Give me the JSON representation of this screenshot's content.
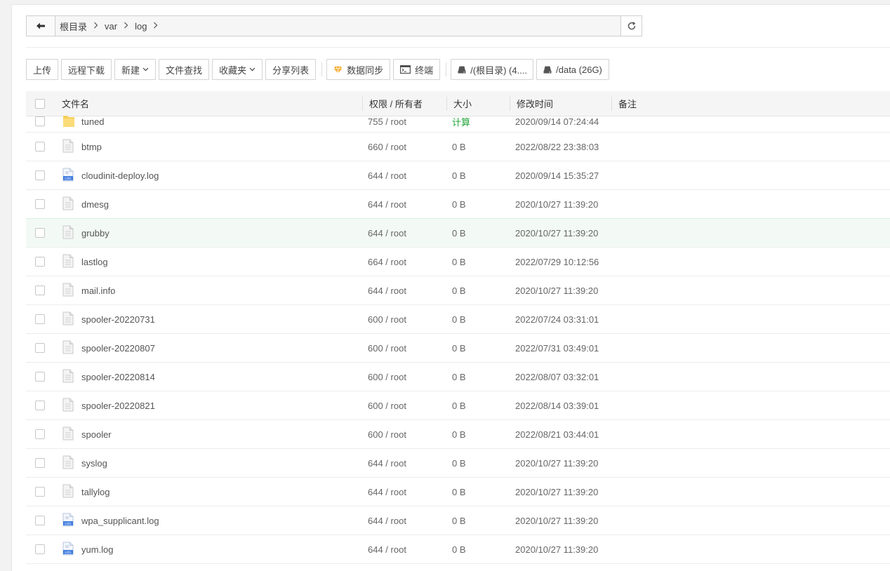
{
  "path": {
    "crumbs": [
      "根目录",
      "var",
      "log"
    ]
  },
  "toolbar": {
    "upload": "上传",
    "remote_download": "远程下载",
    "new": "新建",
    "file_search": "文件查找",
    "favorites": "收藏夹",
    "share_list": "分享列表",
    "data_sync": "数据同步",
    "terminal": "终端",
    "disk_root": "/(根目录) (4....",
    "disk_data": "/data (26G)"
  },
  "table": {
    "headers": {
      "name": "文件名",
      "perm": "权限 / 所有者",
      "size": "大小",
      "mtime": "修改时间",
      "note": "备注"
    },
    "rows": [
      {
        "name": "tuned",
        "type": "folder",
        "perm": "755 / root",
        "size": "计算",
        "mtime": "2020/09/14 07:24:44"
      },
      {
        "name": "btmp",
        "type": "file",
        "perm": "660 / root",
        "size": "0 B",
        "mtime": "2022/08/22 23:38:03"
      },
      {
        "name": "cloudinit-deploy.log",
        "type": "log",
        "perm": "644 / root",
        "size": "0 B",
        "mtime": "2020/09/14 15:35:27"
      },
      {
        "name": "dmesg",
        "type": "file",
        "perm": "644 / root",
        "size": "0 B",
        "mtime": "2020/10/27 11:39:20"
      },
      {
        "name": "grubby",
        "type": "file",
        "perm": "644 / root",
        "size": "0 B",
        "mtime": "2020/10/27 11:39:20"
      },
      {
        "name": "lastlog",
        "type": "file",
        "perm": "664 / root",
        "size": "0 B",
        "mtime": "2022/07/29 10:12:56"
      },
      {
        "name": "mail.info",
        "type": "file",
        "perm": "644 / root",
        "size": "0 B",
        "mtime": "2020/10/27 11:39:20"
      },
      {
        "name": "spooler-20220731",
        "type": "file",
        "perm": "600 / root",
        "size": "0 B",
        "mtime": "2022/07/24 03:31:01"
      },
      {
        "name": "spooler-20220807",
        "type": "file",
        "perm": "600 / root",
        "size": "0 B",
        "mtime": "2022/07/31 03:49:01"
      },
      {
        "name": "spooler-20220814",
        "type": "file",
        "perm": "600 / root",
        "size": "0 B",
        "mtime": "2022/08/07 03:32:01"
      },
      {
        "name": "spooler-20220821",
        "type": "file",
        "perm": "600 / root",
        "size": "0 B",
        "mtime": "2022/08/14 03:39:01"
      },
      {
        "name": "spooler",
        "type": "file",
        "perm": "600 / root",
        "size": "0 B",
        "mtime": "2022/08/21 03:44:01"
      },
      {
        "name": "syslog",
        "type": "file",
        "perm": "644 / root",
        "size": "0 B",
        "mtime": "2020/10/27 11:39:20"
      },
      {
        "name": "tallylog",
        "type": "file",
        "perm": "644 / root",
        "size": "0 B",
        "mtime": "2020/10/27 11:39:20"
      },
      {
        "name": "wpa_supplicant.log",
        "type": "log",
        "perm": "644 / root",
        "size": "0 B",
        "mtime": "2020/10/27 11:39:20"
      },
      {
        "name": "yum.log",
        "type": "log",
        "perm": "644 / root",
        "size": "0 B",
        "mtime": "2020/10/27 11:39:20"
      }
    ]
  },
  "icon_labels": {
    "log_badge": "LOG"
  },
  "colors": {
    "accent_green": "#20a53a",
    "highlight_row": "#f3faf6",
    "folder_yellow": "#f7cf5a",
    "log_blue": "#3d7be0"
  }
}
